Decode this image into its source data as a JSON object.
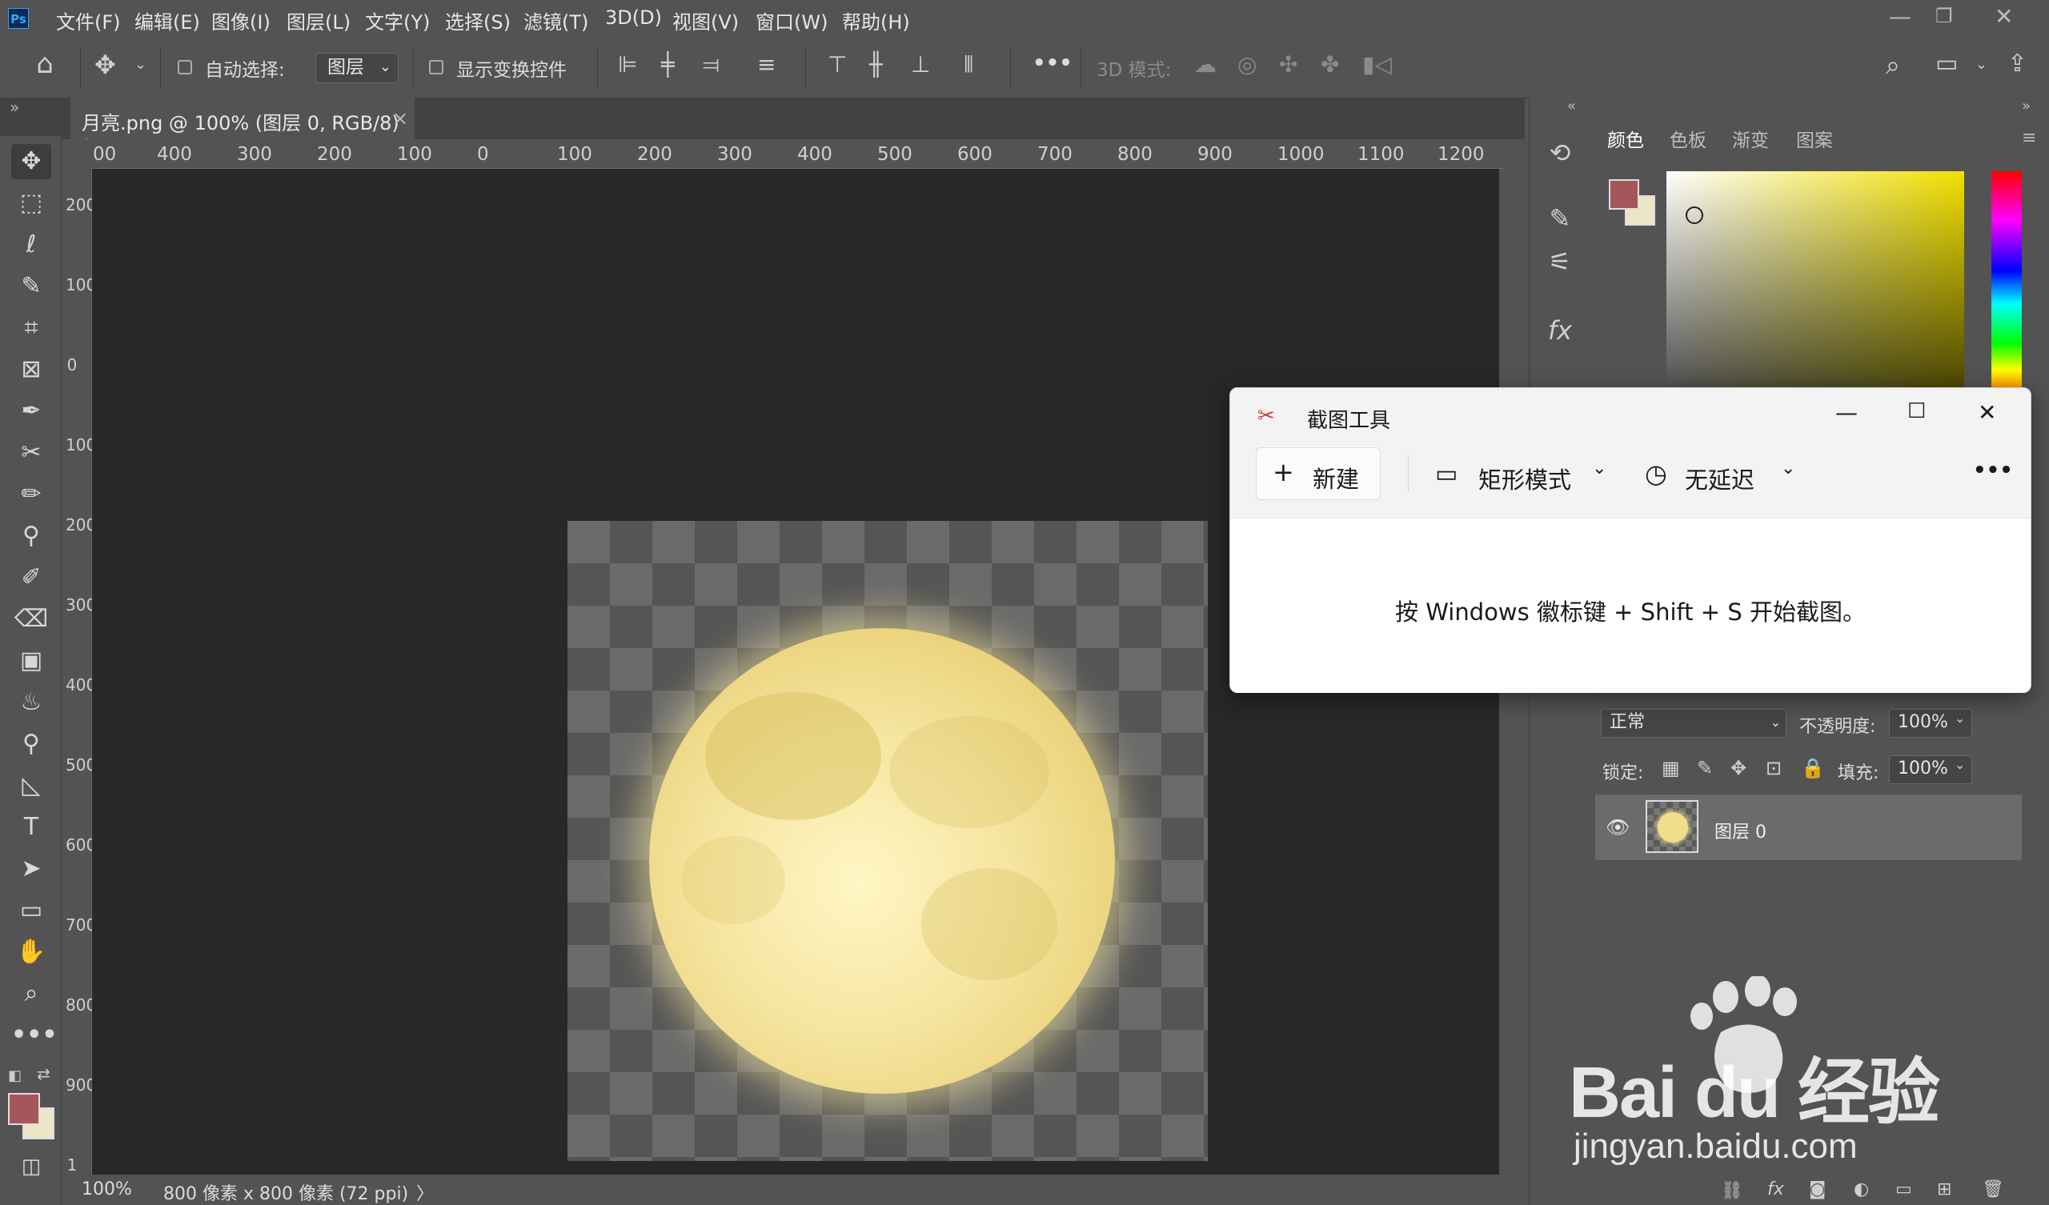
{
  "app": {
    "logo": "Ps",
    "menu": [
      "文件(F)",
      "编辑(E)",
      "图像(I)",
      "图层(L)",
      "文字(Y)",
      "选择(S)",
      "滤镜(T)",
      "3D(D)",
      "视图(V)",
      "窗口(W)",
      "帮助(H)"
    ],
    "window_controls": [
      "minimize-icon",
      "restore-icon",
      "close-icon"
    ]
  },
  "options_bar": {
    "auto_select_label": "自动选择:",
    "auto_select_checked": false,
    "auto_select_target": "图层",
    "show_transform_label": "显示变换控件",
    "show_transform_checked": false,
    "more": "•••",
    "mode_3d_label": "3D 模式:"
  },
  "document_tab": {
    "title": "月亮.png @ 100% (图层 0, RGB/8) *",
    "close": "×"
  },
  "rulers": {
    "top_labels": [
      "00",
      "400",
      "300",
      "200",
      "100",
      "0",
      "100",
      "200",
      "300",
      "400",
      "500",
      "600",
      "700",
      "800",
      "900",
      "1000",
      "1100",
      "1200"
    ],
    "left_labels": [
      "200",
      "100",
      "0",
      "100",
      "200",
      "300",
      "400",
      "500",
      "600",
      "700",
      "800",
      "900",
      "1"
    ]
  },
  "toolbar": {
    "tools": [
      "move-tool",
      "marquee-tool",
      "lasso-tool",
      "quick-select-tool",
      "crop-tool",
      "frame-tool",
      "eyedropper-tool",
      "healing-tool",
      "brush-tool",
      "clone-stamp-tool",
      "history-brush-tool",
      "eraser-tool",
      "gradient-tool",
      "blur-tool",
      "dodge-tool",
      "pen-tool",
      "type-tool",
      "path-select-tool",
      "rectangle-tool",
      "hand-tool",
      "zoom-tool",
      "more-tools"
    ],
    "foreground_color": "#a5565a",
    "background_color": "#ece5c7"
  },
  "status_bar": {
    "zoom": "100%",
    "doc_info": "800 像素 x 800 像素 (72 ppi)",
    "arrow": "〉"
  },
  "color_panel": {
    "tabs": [
      "颜色",
      "色板",
      "渐变",
      "图案"
    ],
    "active_tab": "颜色",
    "foreground": "#a5565a",
    "background": "#ece5c7"
  },
  "layers_panel": {
    "blend_mode": "正常",
    "opacity_label": "不透明度:",
    "opacity_value": "100%",
    "lock_label": "锁定:",
    "fill_label": "填充:",
    "fill_value": "100%",
    "layers": [
      {
        "name": "图层 0",
        "visible": true
      }
    ]
  },
  "snipping_tool": {
    "title": "截图工具",
    "new_label": "新建",
    "mode_label": "矩形模式",
    "delay_label": "无延迟",
    "more": "•••",
    "hint": "按 Windows 徽标键 + Shift + S 开始截图。"
  },
  "watermark": {
    "brand": "Bai du 经验",
    "url": "jingyan.baidu.com"
  }
}
